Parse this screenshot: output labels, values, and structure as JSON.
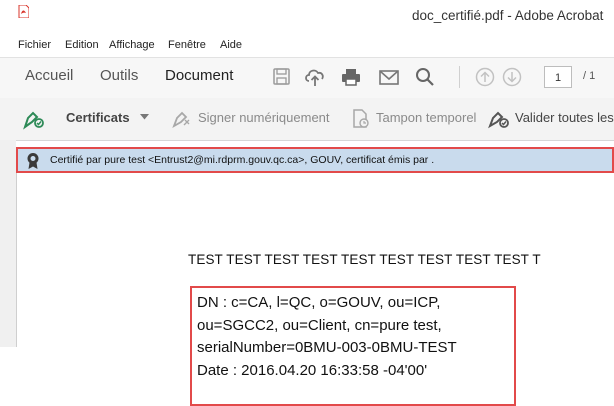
{
  "window": {
    "title": "doc_certifié.pdf - Adobe Acrobat"
  },
  "menu": [
    "Fichier",
    "Edition",
    "Affichage",
    "Fenêtre",
    "Aide"
  ],
  "tabs": {
    "home": "Accueil",
    "tools": "Outils",
    "document": "Document"
  },
  "pagination": {
    "current": "1",
    "total": "/ 1"
  },
  "cert_toolbar": {
    "certificates": "Certificats",
    "sign": "Signer numériquement",
    "timestamp": "Tampon temporel",
    "validate": "Valider toutes les"
  },
  "signature_bar": {
    "text": "Certifié par pure test <Entrust2@mi.rdprm.gouv.qc.ca>, GOUV, certificat émis par ."
  },
  "document": {
    "heading": "TEST TEST TEST TEST TEST TEST TEST TEST TEST T",
    "signature_lines": [
      "DN : c=CA, l=QC, o=GOUV, ou=ICP,",
      "ou=SGCC2, ou=Client, cn=pure test,",
      "serialNumber=0BMU-003-0BMU-TEST",
      "Date : 2016.04.20 16:33:58 -04'00'"
    ]
  },
  "colors": {
    "accent_green": "#2d8a57",
    "info_bar": "#c9dbed",
    "highlight_red": "#e24a4a"
  },
  "icons": [
    "pdf-app-icon",
    "save-icon",
    "upload-icon",
    "print-icon",
    "mail-icon",
    "search-icon",
    "page-up-icon",
    "page-down-icon",
    "certificate-pen-icon",
    "sign-pen-icon",
    "timestamp-icon",
    "validate-icon",
    "ribbon-icon"
  ]
}
